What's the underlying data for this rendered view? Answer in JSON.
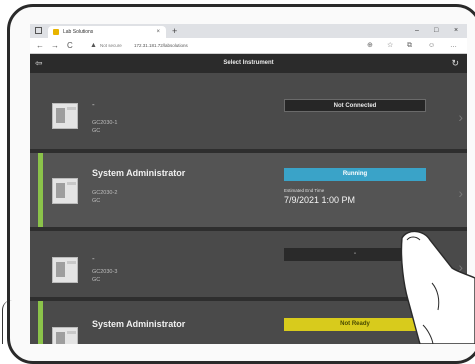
{
  "browser": {
    "tab_title": "Lab Solutions",
    "tab_close": "×",
    "new_tab": "+",
    "min": "–",
    "max": "□",
    "close": "×",
    "back": "←",
    "forward": "→",
    "reload": "C",
    "security_label": "Not secure",
    "address": "172.31.181.72/labsolutions"
  },
  "app": {
    "title": "Select Instrument",
    "back_icon": "exit-icon",
    "refresh_icon": "refresh-icon"
  },
  "instruments": [
    {
      "user": "-",
      "name": "GC2030-1",
      "type": "GC",
      "status": "Not Connected",
      "status_color": "#262626"
    },
    {
      "user": "System Administrator",
      "name": "GC2030-2",
      "type": "GC",
      "status": "Running",
      "status_color": "#3aa3c8",
      "end_label": "Estimated End Time",
      "end_value": "7/9/2021 1:00 PM"
    },
    {
      "user": "-",
      "name": "GC2030-3",
      "type": "GC",
      "status": "-",
      "status_color": "#2a2a2a"
    },
    {
      "user": "System Administrator",
      "name": "",
      "type": "",
      "status": "Not Ready",
      "status_color": "#d8cb1c"
    }
  ],
  "colors": {
    "accent": "#8bc34a",
    "running": "#3aa3c8",
    "not_ready": "#d8cb1c"
  }
}
